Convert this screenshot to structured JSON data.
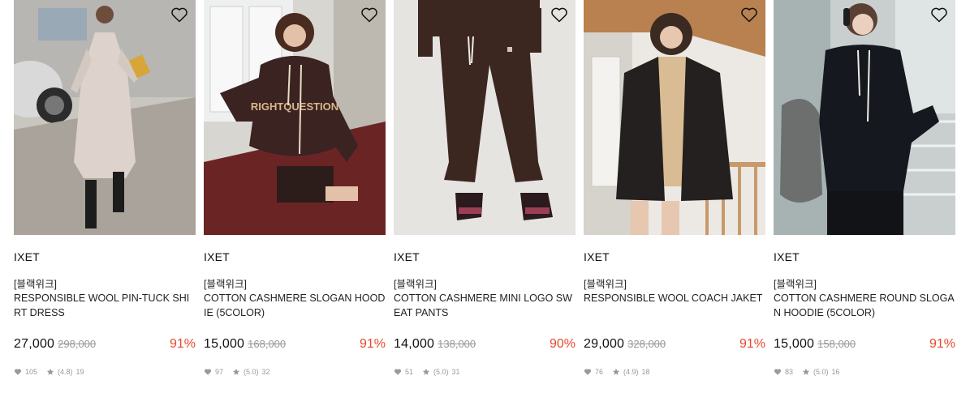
{
  "products": [
    {
      "brand": "IXET",
      "tag": "[블랙위크]",
      "name": "RESPONSIBLE WOOL PIN-TUCK SHIRT DRESS",
      "price": "27,000",
      "original_price": "298,000",
      "discount": "91%",
      "likes": "105",
      "rating": "(4.8)",
      "reviews": "19",
      "image_colors": {
        "bg": "#a9a7a2",
        "fg": "#ddd3cc"
      },
      "wish_icon": "heart-outline-icon"
    },
    {
      "brand": "IXET",
      "tag": "[블랙위크]",
      "name": "COTTON CASHMERE SLOGAN HOODIE (5COLOR)",
      "price": "15,000",
      "original_price": "168,000",
      "discount": "91%",
      "likes": "97",
      "rating": "(5.0)",
      "reviews": "32",
      "image_colors": {
        "bg": "#6b2424",
        "fg": "#3a2321"
      },
      "wish_icon": "heart-outline-icon"
    },
    {
      "brand": "IXET",
      "tag": "[블랙위크]",
      "name": "COTTON CASHMERE MINI LOGO SWEAT PANTS",
      "price": "14,000",
      "original_price": "138,000",
      "discount": "90%",
      "likes": "51",
      "rating": "(5.0)",
      "reviews": "31",
      "image_colors": {
        "bg": "#e6e4e1",
        "fg": "#3b2620"
      },
      "wish_icon": "heart-outline-icon"
    },
    {
      "brand": "IXET",
      "tag": "[블랙위크]",
      "name": "RESPONSIBLE WOOL COACH JAKET",
      "price": "29,000",
      "original_price": "328,000",
      "discount": "91%",
      "likes": "76",
      "rating": "(4.9)",
      "reviews": "18",
      "image_colors": {
        "bg": "#d8d3cd",
        "fg": "#24201f"
      },
      "wish_icon": "heart-outline-icon"
    },
    {
      "brand": "IXET",
      "tag": "[블랙위크]",
      "name": "COTTON CASHMERE ROUND SLOGAN HOODIE (5COLOR)",
      "price": "15,000",
      "original_price": "158,000",
      "discount": "91%",
      "likes": "83",
      "rating": "(5.0)",
      "reviews": "16",
      "image_colors": {
        "bg": "#b9bfbf",
        "fg": "#161820"
      },
      "wish_icon": "heart-outline-icon"
    }
  ],
  "colors": {
    "discount": "#e9482e",
    "muted": "#999999",
    "text": "#222222"
  }
}
